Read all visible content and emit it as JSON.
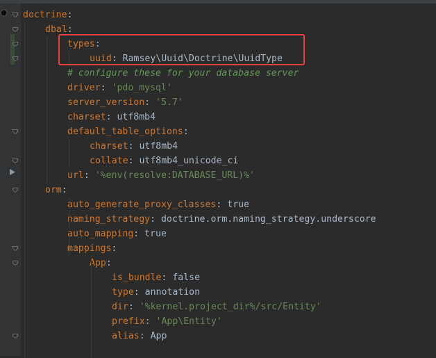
{
  "colors": {
    "key": "#cc7832",
    "plain": "#a9b7c6",
    "string": "#6a8759",
    "comment": "#629755",
    "highlight_border": "#e8403e",
    "background": "#2b2b2b"
  },
  "code_lines": [
    {
      "key": "doctrine",
      "sep": ":",
      "value": "",
      "vtype": ""
    },
    {
      "key": "dbal",
      "sep": ":",
      "value": "",
      "vtype": ""
    },
    {
      "key": "types",
      "sep": ":",
      "value": "",
      "vtype": ""
    },
    {
      "key": "uuid",
      "sep": ": ",
      "value": "Ramsey\\Uuid\\Doctrine\\UuidType",
      "vtype": "plain"
    },
    {
      "key": "",
      "sep": "",
      "value": "# configure these for your database server",
      "vtype": "comment"
    },
    {
      "key": "driver",
      "sep": ": ",
      "value": "'pdo_mysql'",
      "vtype": "string"
    },
    {
      "key": "server_version",
      "sep": ": ",
      "value": "'5.7'",
      "vtype": "string"
    },
    {
      "key": "charset",
      "sep": ": ",
      "value": "utf8mb4",
      "vtype": "plain"
    },
    {
      "key": "default_table_options",
      "sep": ":",
      "value": "",
      "vtype": ""
    },
    {
      "key": "charset",
      "sep": ": ",
      "value": "utf8mb4",
      "vtype": "plain"
    },
    {
      "key": "collate",
      "sep": ": ",
      "value": "utf8mb4_unicode_ci",
      "vtype": "plain"
    },
    {
      "key": "url",
      "sep": ": ",
      "value": "'%env(resolve:DATABASE_URL)%'",
      "vtype": "string"
    },
    {
      "key": "orm",
      "sep": ":",
      "value": "",
      "vtype": ""
    },
    {
      "key": "auto_generate_proxy_classes",
      "sep": ": ",
      "value": "true",
      "vtype": "plain"
    },
    {
      "key": "naming_strategy",
      "sep": ": ",
      "value": "doctrine.orm.naming_strategy.underscore",
      "vtype": "plain"
    },
    {
      "key": "auto_mapping",
      "sep": ": ",
      "value": "true",
      "vtype": "plain"
    },
    {
      "key": "mappings",
      "sep": ":",
      "value": "",
      "vtype": ""
    },
    {
      "key": "App",
      "sep": ":",
      "value": "",
      "vtype": ""
    },
    {
      "key": "is_bundle",
      "sep": ": ",
      "value": "false",
      "vtype": "plain"
    },
    {
      "key": "type",
      "sep": ": ",
      "value": "annotation",
      "vtype": "plain"
    },
    {
      "key": "dir",
      "sep": ": ",
      "value": "'%kernel.project_dir%/src/Entity'",
      "vtype": "string"
    },
    {
      "key": "prefix",
      "sep": ": ",
      "value": "'App\\Entity'",
      "vtype": "string"
    },
    {
      "key": "alias",
      "sep": ": ",
      "value": "App",
      "vtype": "plain"
    }
  ]
}
